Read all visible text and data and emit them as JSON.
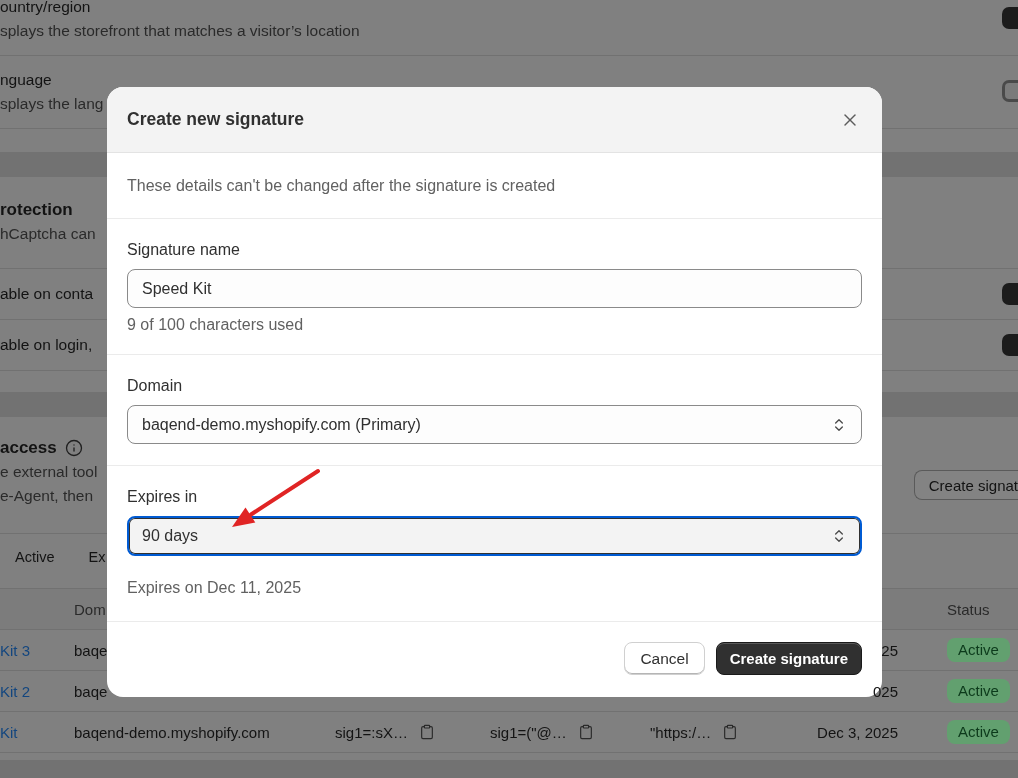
{
  "settings": [
    {
      "title": "ountry/region",
      "description": "splays the storefront that matches a visitor’s location",
      "on": true
    },
    {
      "title": "nguage",
      "description": "splays the lang",
      "on": false
    }
  ],
  "protection": {
    "title": "rotection",
    "description": "hCaptcha can",
    "rows": [
      {
        "label": "able on conta",
        "on": true
      },
      {
        "label": "able on login,",
        "on": true
      }
    ]
  },
  "access": {
    "title": "access",
    "description": [
      "e external tool",
      "e-Agent, then"
    ],
    "button": "Create signat",
    "tabs": [
      {
        "label": "Active",
        "selected": false
      },
      {
        "label": "Ex",
        "selected": false
      }
    ],
    "table": {
      "header": {
        "column_2": "Dom",
        "status": "Status"
      },
      "rows": [
        {
          "column_1": "Kit 3",
          "column_2": "baqe",
          "column_6": "25",
          "status": "Active"
        },
        {
          "column_1": "Kit 2",
          "column_2": "baqe",
          "column_6": "025",
          "status": "Active"
        },
        {
          "column_1": "Kit",
          "column_2": "baqend-demo.myshopify.com",
          "column_3": "sig1=:sX…",
          "column_4": "sig1=(\"@…",
          "column_5": "\"https:/…",
          "column_6": "Dec 3, 2025",
          "status": "Active"
        }
      ]
    }
  },
  "modal": {
    "title": "Create new signature",
    "notice": "These details can't be changed after the signature is created",
    "fields": [
      {
        "kind": "text",
        "label": "Signature name",
        "value": "Speed Kit",
        "help": "9 of 100 characters used",
        "focused": false
      },
      {
        "kind": "select",
        "label": "Domain",
        "value": "baqend-demo.myshopify.com (Primary)",
        "focused": false
      },
      {
        "kind": "select",
        "label": "Expires in",
        "value": "90 days",
        "help": "Expires on Dec 11, 2025",
        "focused": true
      }
    ],
    "buttons": [
      {
        "kind": "secondary",
        "label": "Cancel"
      },
      {
        "kind": "primary",
        "label": "Create signature"
      }
    ]
  },
  "annotation": {
    "kind": "arrow"
  }
}
